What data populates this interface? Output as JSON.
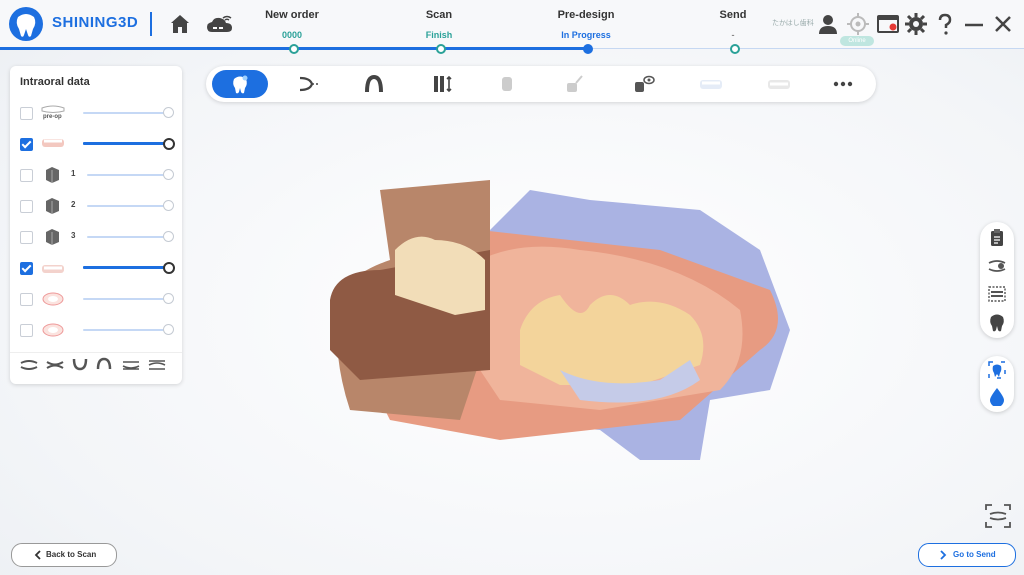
{
  "brand": {
    "name": "SHINING3D"
  },
  "header": {
    "user_name": "たかはし歯科",
    "badge": "Online",
    "steps": [
      {
        "title": "New order",
        "status": "0000",
        "status_color": "#2aa198"
      },
      {
        "title": "Scan",
        "status": "Finish",
        "status_color": "#2aa198"
      },
      {
        "title": "Pre-design",
        "status": "In Progress",
        "status_color": "#1d6fe0"
      },
      {
        "title": "Send",
        "status": "-",
        "status_color": "#888888"
      }
    ],
    "icons": [
      "home-icon",
      "cloud-wifi-icon",
      "user-icon",
      "target-icon",
      "record-icon",
      "gear-icon",
      "help-icon",
      "minimize-icon",
      "close-icon"
    ]
  },
  "panel": {
    "title": "Intraoral data",
    "rows": [
      {
        "label": "pre-op",
        "num": "",
        "checked": false,
        "level": 1.0
      },
      {
        "label": "",
        "num": "",
        "checked": true,
        "level": 1.0
      },
      {
        "label": "",
        "num": "1",
        "checked": false,
        "level": 1.0
      },
      {
        "label": "",
        "num": "2",
        "checked": false,
        "level": 1.0
      },
      {
        "label": "",
        "num": "3",
        "checked": false,
        "level": 1.0
      },
      {
        "label": "",
        "num": "",
        "checked": true,
        "level": 1.0
      },
      {
        "label": "",
        "num": "",
        "checked": false,
        "level": 1.0
      },
      {
        "label": "",
        "num": "",
        "checked": false,
        "level": 1.0
      }
    ]
  },
  "toolbar": {
    "tools": [
      "tooth-select-icon",
      "margin-line-icon",
      "arch-icon",
      "implant-icon",
      "tooth-disabled-icon",
      "brush-disabled-icon",
      "view-icon",
      "lab-disabled-icon",
      "denture-disabled-icon",
      "more-icon"
    ]
  },
  "buttons": {
    "back": "Back to Scan",
    "send": "Go to Send"
  },
  "colors": {
    "accent": "#1d6fe0",
    "success": "#2aa198"
  }
}
